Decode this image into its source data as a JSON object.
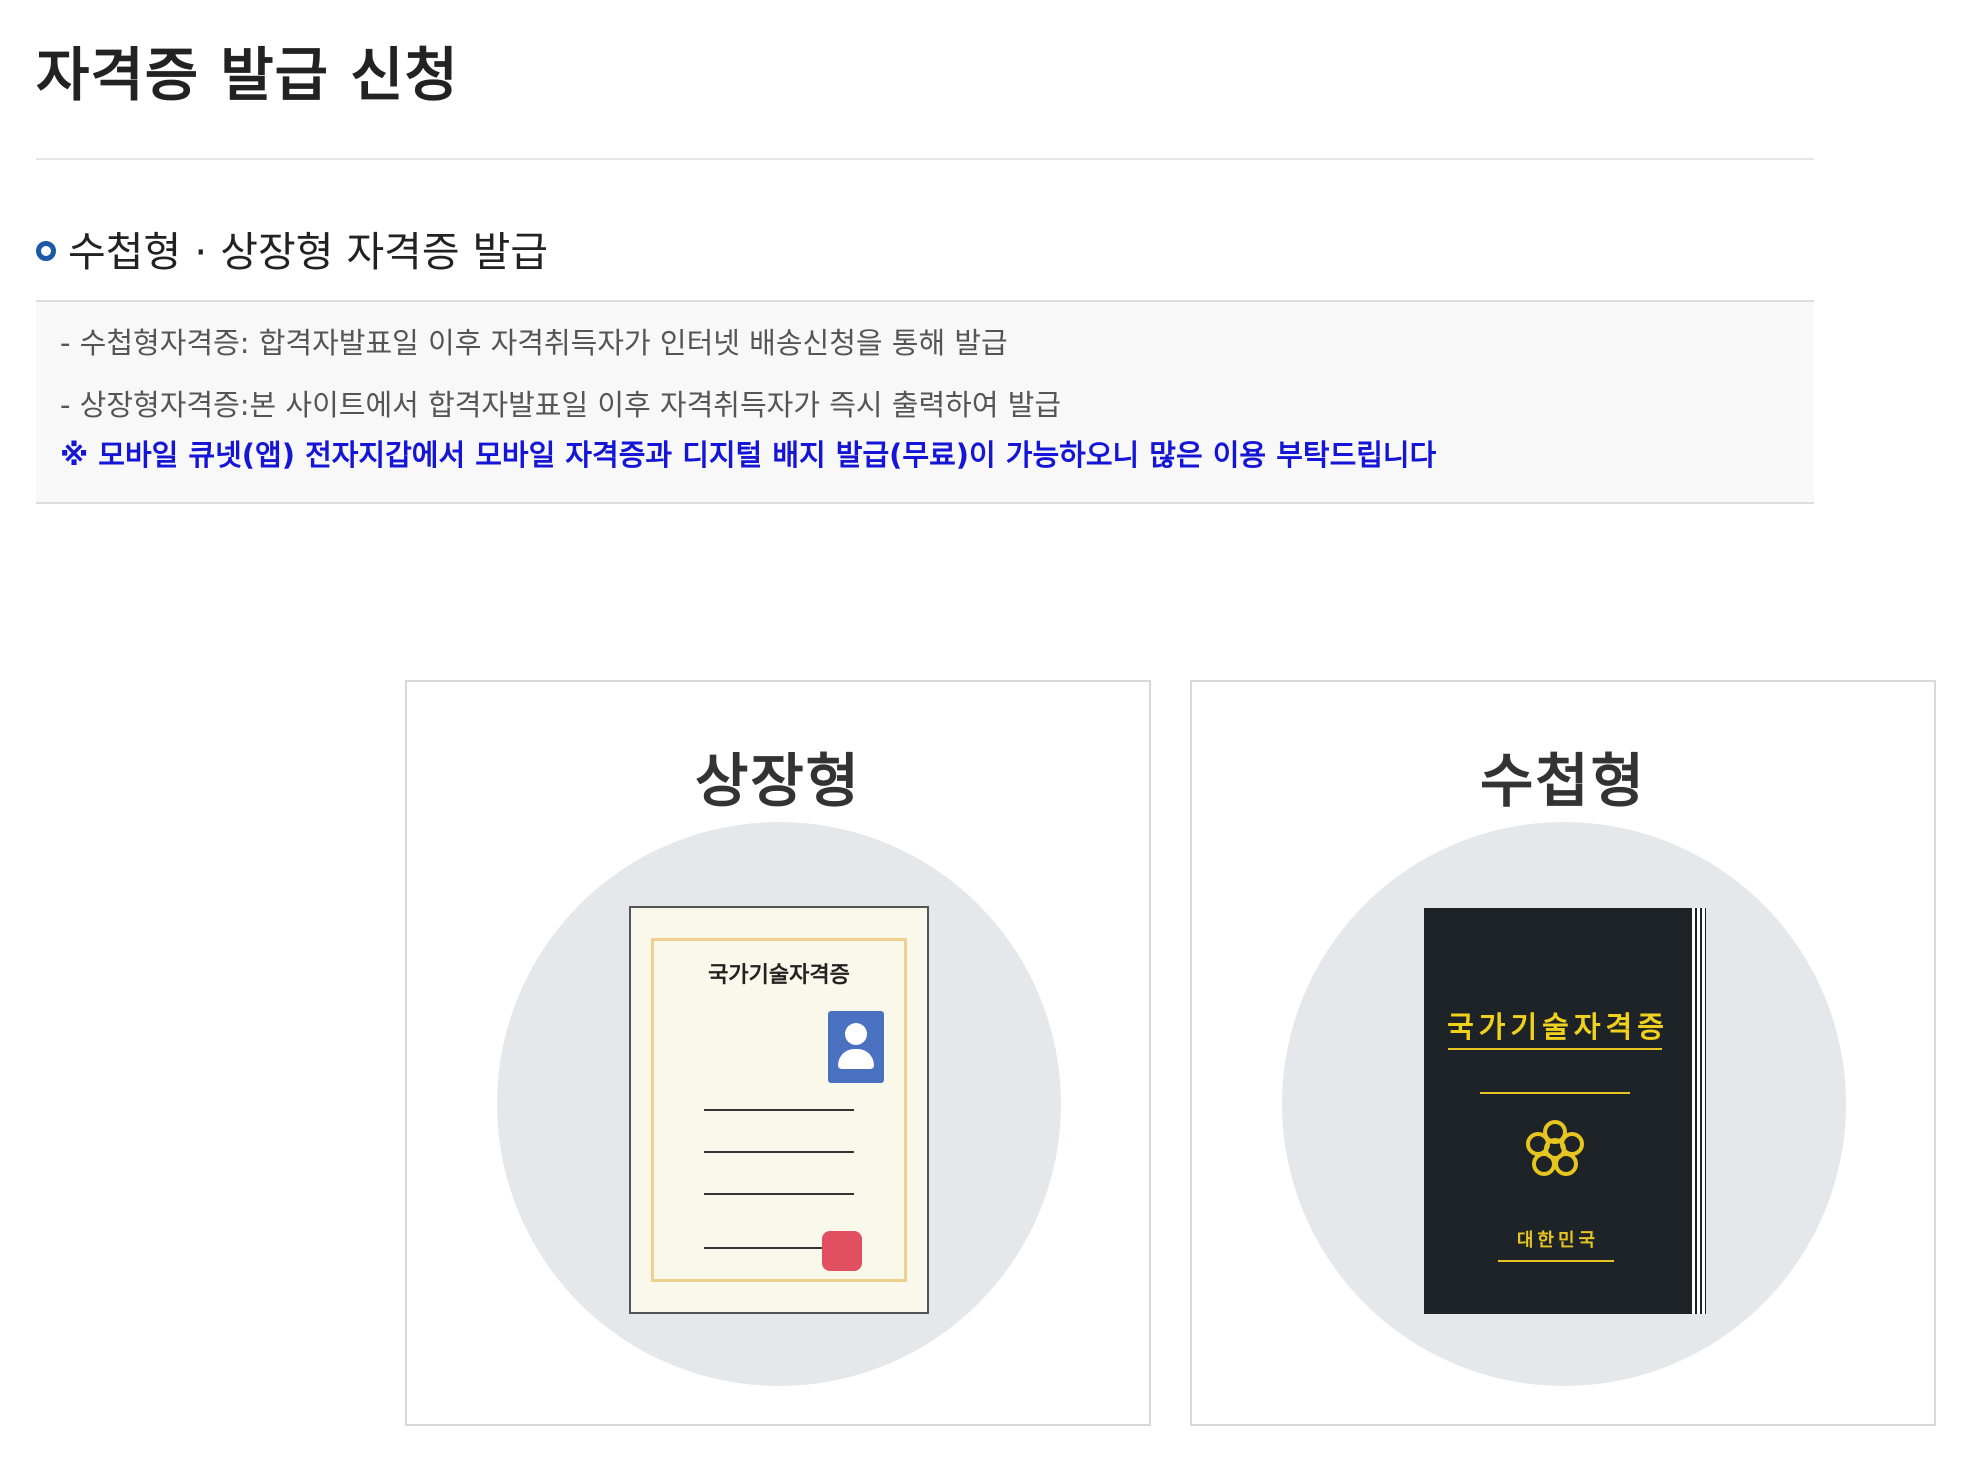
{
  "page": {
    "title": "자격증 발급 신청"
  },
  "section": {
    "title": "수첩형 · 상장형 자격증 발급"
  },
  "info": {
    "line1": "- 수첩형자격증: 합격자발표일 이후 자격취득자가 인터넷 배송신청을 통해 발급",
    "line2": "- 상장형자격증:본 사이트에서 합격자발표일 이후 자격취득자가 즉시 출력하여 발급",
    "note": "※ 모바일 큐넷(앱) 전자지갑에서 모바일 자격증과 디지털 배지 발급(무료)이 가능하오니 많은 이용 부탁드립니다",
    "note_color": "#1515d8"
  },
  "cards": [
    {
      "title": "상장형",
      "image_text": "국가기술자격증",
      "icon": "certificate-icon",
      "colors": {
        "paper": "#faf8ea",
        "border": "#f0cf92",
        "photo": "#4b72c0",
        "seal": "#e05060"
      }
    },
    {
      "title": "수첩형",
      "image_text": "국가기술자격증",
      "country_text": "대한민국",
      "icon": "booklet-icon",
      "colors": {
        "cover": "#1e2327",
        "gold": "#f0d21c"
      }
    }
  ],
  "colors": {
    "accent": "#1a5aa6",
    "circle": "#e4e8eb"
  }
}
